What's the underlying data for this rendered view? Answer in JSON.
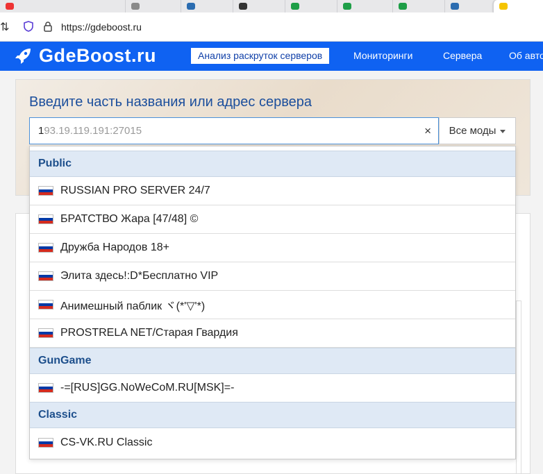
{
  "browser": {
    "url": "https://gdeboost.ru"
  },
  "header": {
    "logo": "GdeBoost.ru",
    "nav": {
      "active": "Анализ раскруток серверов",
      "items": [
        "Мониторинги",
        "Сервера",
        "Об авто"
      ]
    }
  },
  "search": {
    "title": "Введите часть названия или адрес сервера",
    "typed": "1",
    "placeholder_rest": "93.19.119.191:27015",
    "clear": "×",
    "mode": "Все моды"
  },
  "dropdown": {
    "groups": [
      {
        "name": "Public",
        "servers": [
          "RUSSIAN PRO SERVER 24/7",
          "БРАТСТВО Жара [47/48] ©",
          "Дружба Народов 18+",
          "Элита здесь!:D*Бесплатно VIP",
          "Анимешный паблик ヾ(*'▽'*)",
          "PROSTRELA NET/Старая Гвардия"
        ]
      },
      {
        "name": "GunGame",
        "servers": [
          "-=[RUS]GG.NoWeCoM.RU[MSK]=-"
        ]
      },
      {
        "name": "Classic",
        "servers": [
          "CS-VK.RU Classic"
        ]
      }
    ]
  },
  "colors": {
    "brand": "#0f62f2",
    "group_bg": "#dfe9f5",
    "group_text": "#1d4f8c"
  },
  "icons": {
    "flag": "russia-flag-icon",
    "logo": "rocket-icon"
  }
}
